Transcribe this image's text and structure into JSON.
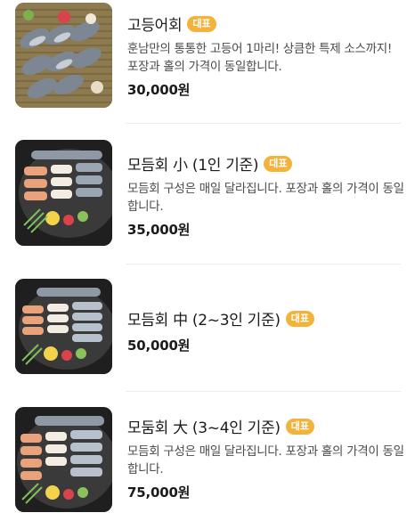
{
  "badge_label": "대표",
  "colors": {
    "badge": "#f3b33b",
    "divider": "#ececec"
  },
  "items": [
    {
      "name": "고등어회",
      "description": "훈남만의 통통한 고등어 1마리! 상큼한 특제 소스까지! 포장과 홀의 가격이 동일합니다.",
      "price": "30,000원",
      "image": "mackerel-sashimi-platter"
    },
    {
      "name": "모듬회 小 (1인 기준)",
      "description": "모듬회 구성은 매일 달라집니다. 포장과 홀의 가격이 동일합니다.",
      "price": "35,000원",
      "image": "assorted-sashimi-small"
    },
    {
      "name": "모듬회 中 (2~3인 기준)",
      "description": "",
      "price": "50,000원",
      "image": "assorted-sashimi-medium"
    },
    {
      "name": "모둠회 大 (3~4인 기준)",
      "description": "모듬회 구성은 매일 달라집니다. 포장과 홀의 가격이 동일합니다.",
      "price": "75,000원",
      "image": "assorted-sashimi-large"
    }
  ]
}
